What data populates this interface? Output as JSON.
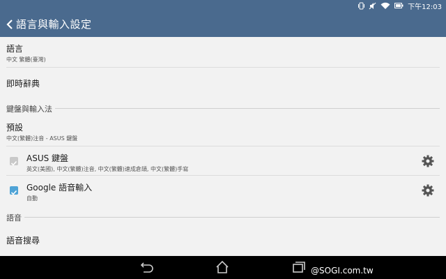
{
  "status": {
    "time": "下午12:03"
  },
  "header": {
    "title": "語言與輸入設定"
  },
  "language": {
    "title": "語言",
    "value": "中文 繁體(臺灣)"
  },
  "dictionary": {
    "title": "即時辭典"
  },
  "keyboard_section": {
    "label": "鍵盤與輸入法"
  },
  "default_ime": {
    "title": "預設",
    "value": "中文(繁體)注音 - ASUS 鍵盤"
  },
  "asus_keyboard": {
    "title": "ASUS 鍵盤",
    "summary": "英文(美國), 中文(繁體)注音, 中文(繁體)速成倉頡, 中文(繁體)手寫",
    "checked": false
  },
  "google_voice": {
    "title": "Google 語音輸入",
    "summary": "自動",
    "checked": true
  },
  "speech_section": {
    "label": "語音"
  },
  "voice_search": {
    "title": "語音搜尋"
  },
  "watermark": "@SOGI.com.tw",
  "colors": {
    "bar": "#4a6a8e",
    "check": "#4fa3d6"
  },
  "icons": [
    "vibrate-icon",
    "mute-icon",
    "wifi-icon",
    "battery-icon",
    "back-arrow-icon",
    "gear-icon",
    "nav-back-icon",
    "nav-home-icon",
    "nav-recents-icon"
  ]
}
